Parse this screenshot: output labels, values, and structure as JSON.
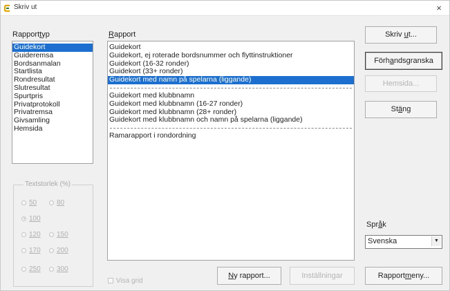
{
  "window": {
    "title": "Skriv ut",
    "close_glyph": "×",
    "icon": "app-icon"
  },
  "report_type": {
    "label": "Rapporttyp",
    "items": [
      "Guidekort",
      "Guideremsa",
      "Bordsanmalan",
      "Startlista",
      "Rondresultat",
      "Slutresultat",
      "Spurtpris",
      "Privatprotokoll",
      "Privatremsa",
      "Givsamling",
      "Hemsida"
    ],
    "selected_index": 0
  },
  "report": {
    "label": "Rapport",
    "groups": [
      [
        "Guidekort",
        "Guidekort, ej roterade bordsnummer och flyttinstruktioner",
        "Guidekort (16-32 ronder)",
        "Guidekort (33+ ronder)",
        "Guidekort med namn på spelarna (liggande)"
      ],
      [
        "Guidekort med klubbnamn",
        "Guidekort med klubbnamn (16-27 ronder)",
        "Guidekort med klubbnamn (28+ ronder)",
        "Guidekort med klubbnamn och namn på spelarna (liggande)"
      ],
      [
        "Ramarapport i rondordning"
      ]
    ],
    "selected": "Guidekort med namn på spelarna (liggande)"
  },
  "font_size": {
    "title": "Textstorlek (%)",
    "options": [
      "50",
      "80",
      "100",
      "120",
      "150",
      "170",
      "200",
      "250",
      "300"
    ],
    "selected": "100"
  },
  "show_grid": {
    "label": "Visa grid",
    "checked": false
  },
  "buttons": {
    "print": "Skriv ut...",
    "preview": "Förhandsgranska",
    "homepage": "Hemsida...",
    "close": "Stäng",
    "new_report": "Ny rapport...",
    "settings": "Inställningar",
    "report_menu": "Rapportmeny..."
  },
  "language": {
    "label": "Språk",
    "value": "Svenska"
  },
  "colors": {
    "selection": "#1c6fcf",
    "window_bg": "#f0f0f0"
  }
}
